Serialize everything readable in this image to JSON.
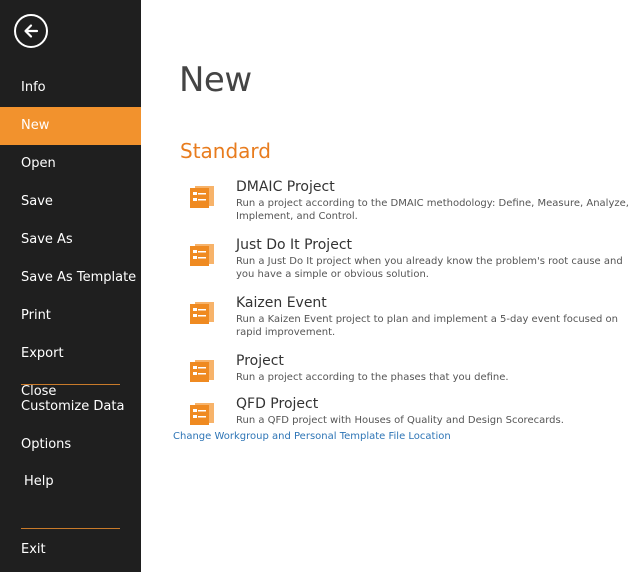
{
  "sidebar": {
    "items": [
      {
        "label": "Info"
      },
      {
        "label": "New"
      },
      {
        "label": "Open"
      },
      {
        "label": "Save"
      },
      {
        "label": "Save As"
      },
      {
        "label": "Save As Template"
      },
      {
        "label": "Print"
      },
      {
        "label": "Export"
      },
      {
        "label": "Close"
      },
      {
        "label": "Customize Data"
      },
      {
        "label": "Options"
      },
      {
        "label": "Help"
      },
      {
        "label": "Exit"
      }
    ]
  },
  "main": {
    "title": "New",
    "section_title": "Standard",
    "templates": [
      {
        "name": "DMAIC Project",
        "description": "Run a project according to the DMAIC methodology: Define, Measure, Analyze, Implement, and Control."
      },
      {
        "name": "Just Do It Project",
        "description": "Run a Just Do It project when you already know the problem's root cause and you have a simple or obvious solution."
      },
      {
        "name": "Kaizen Event",
        "description": "Run a Kaizen Event project to plan and implement a 5-day event focused on rapid improvement."
      },
      {
        "name": "Project",
        "description": "Run a project according to the phases that you define."
      },
      {
        "name": "QFD Project",
        "description": "Run a QFD project with Houses of Quality and Design Scorecards."
      }
    ],
    "link_text": "Change Workgroup and Personal Template File Location"
  },
  "colors": {
    "sidebar_bg": "#1f1f1f",
    "accent": "#f2922d",
    "section_title": "#e87c1e",
    "link": "#2e75b6"
  },
  "icons": {
    "back": "back-arrow-icon",
    "template": "project-template-icon"
  }
}
